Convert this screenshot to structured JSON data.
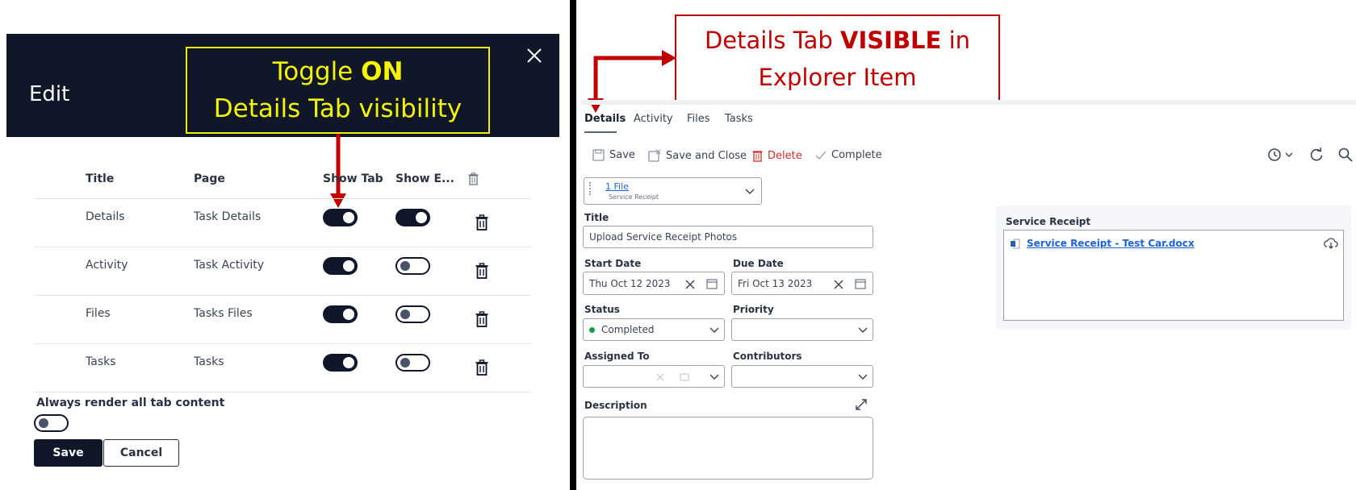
{
  "left": {
    "edit_title": "Edit",
    "callout_line1_prefix": "Toggle ",
    "callout_line1_bold": "ON",
    "callout_line2": "Details Tab visibility",
    "columns": {
      "title": "Title",
      "page": "Page",
      "show_tab": "Show Tab",
      "show_e": "Show E..."
    },
    "rows": [
      {
        "title": "Details",
        "page": "Task Details",
        "show_tab": true,
        "show_e": true
      },
      {
        "title": "Activity",
        "page": "Task Activity",
        "show_tab": true,
        "show_e": false
      },
      {
        "title": "Files",
        "page": "Tasks Files",
        "show_tab": true,
        "show_e": false
      },
      {
        "title": "Tasks",
        "page": "Tasks",
        "show_tab": true,
        "show_e": false
      }
    ],
    "always_render_label": "Always render all tab content",
    "always_render_on": false,
    "save_label": "Save",
    "cancel_label": "Cancel"
  },
  "right": {
    "callout_line1_prefix": "Details Tab ",
    "callout_line1_bold": "VISIBLE",
    "callout_line1_suffix": " in",
    "callout_line2": "Explorer Item",
    "tabs": [
      "Details",
      "Activity",
      "Files",
      "Tasks"
    ],
    "active_tab": "Details",
    "toolbar": {
      "save": "Save",
      "save_close": "Save and Close",
      "delete": "Delete",
      "complete": "Complete"
    },
    "file_picker": {
      "link": "1 File",
      "sub": "Service Receipt"
    },
    "title_label": "Title",
    "title_value": "Upload Service Receipt Photos",
    "start_label": "Start Date",
    "start_value": "Thu Oct 12 2023",
    "due_label": "Due Date",
    "due_value": "Fri Oct 13 2023",
    "status_label": "Status",
    "status_value": "Completed",
    "priority_label": "Priority",
    "priority_value": "",
    "assigned_label": "Assigned To",
    "contributors_label": "Contributors",
    "description_label": "Description",
    "service_receipt_title": "Service Receipt",
    "service_receipt_file": "Service Receipt - Test Car.docx"
  },
  "colors": {
    "navy": "#0f1729",
    "callout_yellow": "#f2f200",
    "callout_red": "#c00000",
    "status_green": "#1a9a4a",
    "link_blue": "#1d63d8",
    "delete_red": "#d12b2b"
  }
}
